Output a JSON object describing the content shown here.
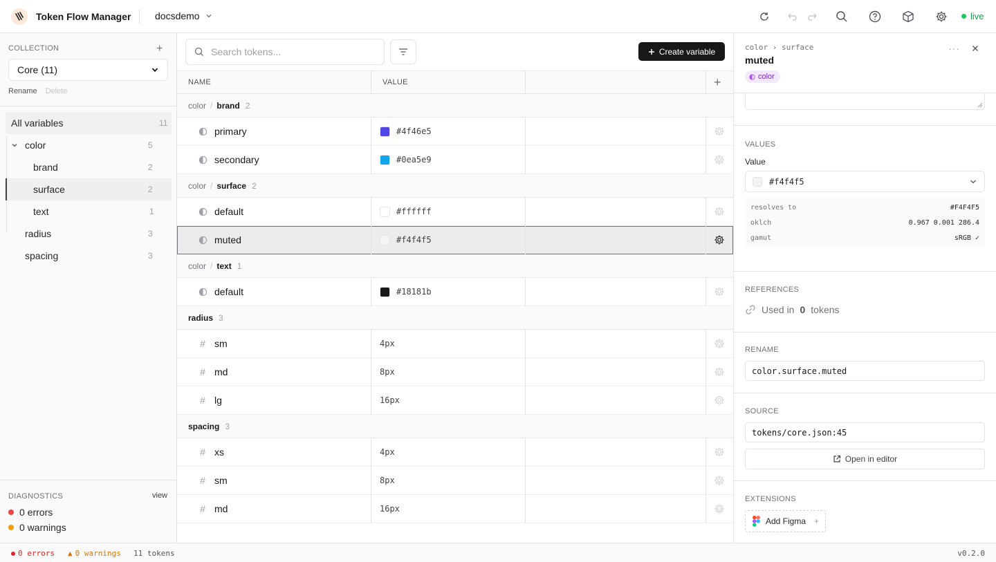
{
  "app": {
    "title": "Token Flow Manager",
    "project": "docsdemo",
    "live_label": "live"
  },
  "sidebar": {
    "collection_label": "COLLECTION",
    "collection_value": "Core (11)",
    "rename_label": "Rename",
    "delete_label": "Delete",
    "all_label": "All variables",
    "all_count": "11",
    "tree": {
      "color": {
        "label": "color",
        "count": "5"
      },
      "brand": {
        "label": "brand",
        "count": "2"
      },
      "surface": {
        "label": "surface",
        "count": "2"
      },
      "text": {
        "label": "text",
        "count": "1"
      },
      "radius": {
        "label": "radius",
        "count": "3"
      },
      "spacing": {
        "label": "spacing",
        "count": "3"
      }
    },
    "diagnostics_label": "DIAGNOSTICS",
    "view_label": "view",
    "errors": "0 errors",
    "warnings": "0 warnings"
  },
  "main": {
    "search_placeholder": "Search tokens...",
    "create_label": "Create variable",
    "col_name": "NAME",
    "col_value": "VALUE",
    "groups": {
      "brand": {
        "parent": "color",
        "sep": "/",
        "name": "brand",
        "count": "2"
      },
      "surface": {
        "parent": "color",
        "sep": "/",
        "name": "surface",
        "count": "2"
      },
      "text": {
        "parent": "color",
        "sep": "/",
        "name": "text",
        "count": "1"
      },
      "radius": {
        "name": "radius",
        "count": "3"
      },
      "spacing": {
        "name": "spacing",
        "count": "3"
      }
    },
    "tokens": [
      {
        "name": "primary",
        "value": "#4f46e5",
        "kind": "color"
      },
      {
        "name": "secondary",
        "value": "#0ea5e9",
        "kind": "color"
      },
      {
        "name": "default",
        "value": "#ffffff",
        "kind": "color"
      },
      {
        "name": "muted",
        "value": "#f4f4f5",
        "kind": "color"
      },
      {
        "name": "default",
        "value": "#18181b",
        "kind": "color"
      },
      {
        "name": "sm",
        "value": "4px",
        "kind": "dimension",
        "icon": "#"
      },
      {
        "name": "md",
        "value": "8px",
        "kind": "dimension",
        "icon": "#"
      },
      {
        "name": "lg",
        "value": "16px",
        "kind": "dimension",
        "icon": "#"
      },
      {
        "name": "xs",
        "value": "4px",
        "kind": "dimension",
        "icon": "#"
      },
      {
        "name": "sm",
        "value": "8px",
        "kind": "dimension",
        "icon": "#"
      },
      {
        "name": "md",
        "value": "16px",
        "kind": "dimension",
        "icon": "#"
      }
    ]
  },
  "panel": {
    "crumb_parent": "color",
    "crumb_sep": "›",
    "crumb_child": "surface",
    "title": "muted",
    "type_badge": "color",
    "values_label": "VALUES",
    "value_field_label": "Value",
    "value": "#f4f4f5",
    "resolves_key": "resolves to",
    "resolves_val": "#F4F4F5",
    "oklch_key": "oklch",
    "oklch_val": "0.967 0.001 286.4",
    "gamut_key": "gamut",
    "gamut_val": "sRGB ✓",
    "references_label": "REFERENCES",
    "used_prefix": "Used in",
    "used_count": "0",
    "used_suffix": "tokens",
    "rename_label": "RENAME",
    "rename_value": "color.surface.muted",
    "source_label": "SOURCE",
    "source_value": "tokens/core.json:45",
    "open_editor": "Open in editor",
    "extensions_label": "EXTENSIONS",
    "add_figma": "Add Figma"
  },
  "status": {
    "errors": "0 errors",
    "warnings": "0 warnings",
    "tokens": "11 tokens",
    "version": "v0.2.0"
  },
  "colors": {
    "accent": "#18181b",
    "live": "#22c55e",
    "error": "#dc2626",
    "warning": "#f59e0b",
    "badge": "#7e22ce"
  }
}
